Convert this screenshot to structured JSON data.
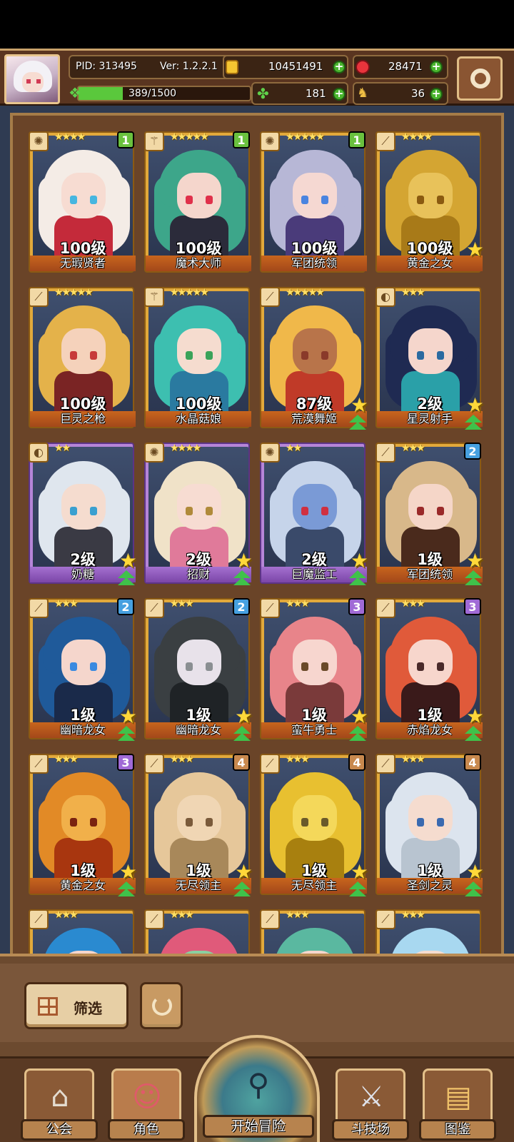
{
  "header": {
    "pid": "PID: 313495",
    "version": "Ver: 1.2.2.1",
    "gold": "10451491",
    "gems": "28471",
    "exp": "389/1500",
    "exp_progress": 0.26,
    "clover": "181",
    "horn": "36"
  },
  "heroes": [
    {
      "name": "无瑕贤者",
      "level": "100级",
      "stars": "★★★★",
      "rank": "1",
      "frame": "gold",
      "palette": [
        "#f4ece6",
        "#f7dcd2",
        "#c42a3a",
        "#46b6e0"
      ],
      "badge_star": false,
      "badge_up": false
    },
    {
      "name": "魔术大师",
      "level": "100级",
      "stars": "★★★★★",
      "rank": "1",
      "frame": "gold",
      "palette": [
        "#3da68a",
        "#f5d6cc",
        "#2b2b3a",
        "#e0304a"
      ],
      "badge_star": false,
      "badge_up": false
    },
    {
      "name": "军团统领",
      "level": "100级",
      "stars": "★★★★★",
      "rank": "1",
      "frame": "gold",
      "palette": [
        "#b7b7d6",
        "#f5d8d2",
        "#4a3b7a",
        "#4a84e0"
      ],
      "badge_star": false,
      "badge_up": false
    },
    {
      "name": "黄金之女",
      "level": "100级",
      "stars": "★★★★",
      "rank": "",
      "frame": "gold",
      "palette": [
        "#d4a532",
        "#e8c25a",
        "#a87a18",
        "#8a5a10"
      ],
      "badge_star": true,
      "badge_up": false
    },
    {
      "name": "巨灵之枪",
      "level": "100级",
      "stars": "★★★★★",
      "rank": "",
      "frame": "gold",
      "palette": [
        "#e4b24a",
        "#f5d2bb",
        "#7a2424",
        "#c73a3a"
      ],
      "badge_star": false,
      "badge_up": false
    },
    {
      "name": "水晶菇娘",
      "level": "100级",
      "stars": "★★★★★",
      "rank": "",
      "frame": "gold",
      "palette": [
        "#3dbfb0",
        "#f5dccf",
        "#2a7aa0",
        "#3aa35a"
      ],
      "badge_star": false,
      "badge_up": false
    },
    {
      "name": "荒漠舞姬",
      "level": "87级",
      "stars": "★★★★★",
      "rank": "",
      "frame": "gold",
      "palette": [
        "#f0b84a",
        "#b8744a",
        "#c03a28",
        "#8a3a2a"
      ],
      "badge_star": true,
      "badge_up": true
    },
    {
      "name": "星灵射手",
      "level": "2级",
      "stars": "★★★",
      "rank": "",
      "frame": "gold",
      "palette": [
        "#1f2a52",
        "#f5d6cc",
        "#2aa0a8",
        "#2a6aa0"
      ],
      "badge_star": true,
      "badge_up": true
    },
    {
      "name": "奶糖",
      "level": "2级",
      "stars": "★★",
      "rank": "",
      "frame": "purple",
      "palette": [
        "#dfe6ee",
        "#f5dccf",
        "#3a3a44",
        "#3aa0d0"
      ],
      "badge_star": true,
      "badge_up": true
    },
    {
      "name": "招财",
      "level": "2级",
      "stars": "★★★★",
      "rank": "",
      "frame": "purple",
      "palette": [
        "#f0e2c8",
        "#f7dcd2",
        "#e07a9a",
        "#b08a3a"
      ],
      "badge_star": true,
      "badge_up": true
    },
    {
      "name": "巨魔监工",
      "level": "2级",
      "stars": "★★",
      "rank": "",
      "frame": "purple",
      "palette": [
        "#c6d4ea",
        "#7a9ad6",
        "#3a4a6a",
        "#d03040"
      ],
      "badge_star": true,
      "badge_up": true
    },
    {
      "name": "军团统领",
      "level": "1级",
      "stars": "★★★",
      "rank": "2",
      "frame": "gold",
      "palette": [
        "#d8b88a",
        "#f5d6c8",
        "#4a2a1c",
        "#9a2a2a"
      ],
      "badge_star": true,
      "badge_up": true
    },
    {
      "name": "幽暗龙女",
      "level": "1级",
      "stars": "★★★",
      "rank": "2",
      "frame": "gold",
      "palette": [
        "#1f5a9a",
        "#f5d6cc",
        "#1a2a4a",
        "#3a8ae0"
      ],
      "badge_star": true,
      "badge_up": true
    },
    {
      "name": "幽暗龙女",
      "level": "1级",
      "stars": "★★★",
      "rank": "2",
      "frame": "gold",
      "palette": [
        "#3a3f42",
        "#e8e2ea",
        "#1f2326",
        "#8a8f92"
      ],
      "badge_star": true,
      "badge_up": true
    },
    {
      "name": "蛮牛勇士",
      "level": "1级",
      "stars": "★★★",
      "rank": "3",
      "frame": "gold",
      "palette": [
        "#e8848a",
        "#f7d6cf",
        "#7a3a3a",
        "#6a4a2a"
      ],
      "badge_star": true,
      "badge_up": true
    },
    {
      "name": "赤焰龙女",
      "level": "1级",
      "stars": "★★★",
      "rank": "3",
      "frame": "gold",
      "palette": [
        "#e05a3a",
        "#f7d6cc",
        "#3a1a1a",
        "#4a2a2a"
      ],
      "badge_star": true,
      "badge_up": true
    },
    {
      "name": "黄金之女",
      "level": "1级",
      "stars": "★★★",
      "rank": "3",
      "frame": "gold",
      "palette": [
        "#e28a26",
        "#f1b04a",
        "#a8360f",
        "#7a2210"
      ],
      "badge_star": true,
      "badge_up": true
    },
    {
      "name": "无尽领主",
      "level": "1级",
      "stars": "★★★",
      "rank": "4",
      "frame": "gold",
      "palette": [
        "#e6c79a",
        "#f0d6b4",
        "#a8885a",
        "#7a5a3a"
      ],
      "badge_star": true,
      "badge_up": true
    },
    {
      "name": "无尽领主",
      "level": "1级",
      "stars": "★★★",
      "rank": "4",
      "frame": "gold",
      "palette": [
        "#e8c030",
        "#f4d85a",
        "#a8800f",
        "#6a5a2a"
      ],
      "badge_star": true,
      "badge_up": true
    },
    {
      "name": "圣剑之灵",
      "level": "1级",
      "stars": "★★★",
      "rank": "4",
      "frame": "gold",
      "palette": [
        "#dce4ee",
        "#f5dccf",
        "#b8c4d0",
        "#3a6ab0"
      ],
      "badge_star": true,
      "badge_up": true
    },
    {
      "name": "",
      "level": "",
      "stars": "★★★",
      "rank": "",
      "frame": "gold",
      "palette": [
        "#2a8ad0",
        "#f5d6cc",
        "#3ab0c0",
        "#1a5a8a"
      ],
      "badge_star": false,
      "badge_up": false
    },
    {
      "name": "",
      "level": "",
      "stars": "★★★",
      "rank": "",
      "frame": "gold",
      "palette": [
        "#e05a7a",
        "#8ad0a0",
        "#2a6a4a",
        "#3a8a5a"
      ],
      "badge_star": false,
      "badge_up": false
    },
    {
      "name": "",
      "level": "",
      "stars": "★★★",
      "rank": "",
      "frame": "gold",
      "palette": [
        "#5ab8a0",
        "#f5d6cc",
        "#2a5a6a",
        "#2a8a7a"
      ],
      "badge_star": false,
      "badge_up": false
    },
    {
      "name": "",
      "level": "",
      "stars": "★★★",
      "rank": "",
      "frame": "gold",
      "palette": [
        "#a8d8f0",
        "#f5dccf",
        "#e0c040",
        "#3a8ad0"
      ],
      "badge_star": false,
      "badge_up": false
    }
  ],
  "filter": {
    "label": "筛选"
  },
  "nav": {
    "guild": "公会",
    "characters": "角色",
    "adventure": "开始冒险",
    "arena": "斗技场",
    "codex": "图鉴"
  },
  "icons": {
    "class_icons": [
      "staff-icon",
      "wand-icon",
      "staff-icon",
      "sword-icon",
      "sword-icon",
      "wand-icon",
      "sword-icon",
      "bow-icon",
      "bow-icon",
      "staff-icon",
      "staff-icon",
      "sword-icon",
      "sword-icon",
      "sword-icon",
      "sword-icon",
      "sword-icon",
      "sword-icon",
      "sword-icon",
      "sword-icon",
      "sword-icon",
      "sword-icon",
      "sword-icon",
      "sword-icon",
      "sword-icon"
    ]
  }
}
